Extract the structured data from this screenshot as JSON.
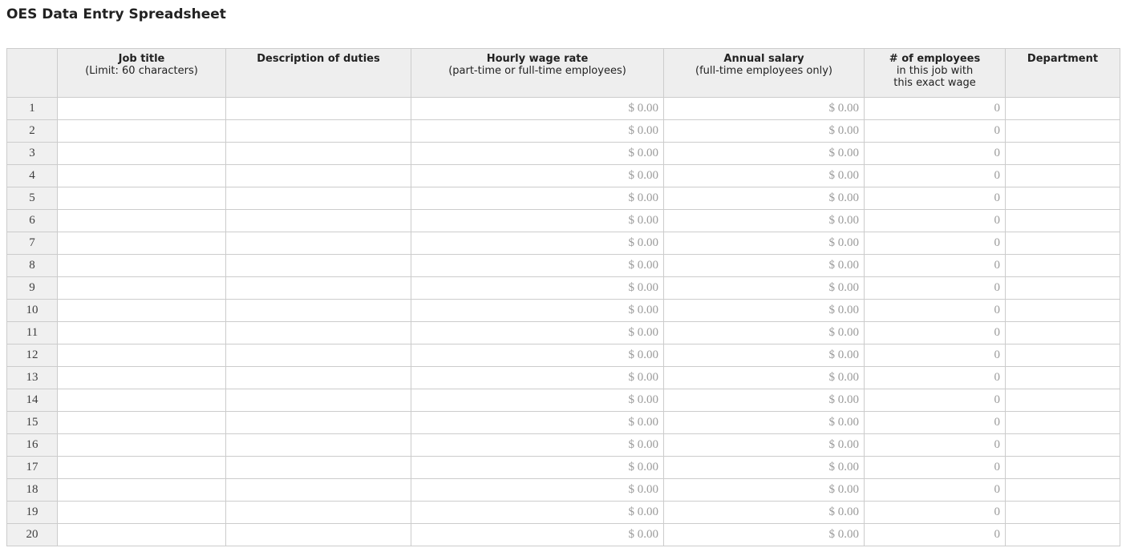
{
  "page": {
    "title": "OES Data Entry Spreadsheet"
  },
  "table": {
    "header": {
      "row_number": "",
      "job_title": {
        "label": "Job title",
        "sub": "(Limit: 60 characters)"
      },
      "description": {
        "label": "Description of duties",
        "sub": ""
      },
      "hourly_wage": {
        "label": "Hourly wage rate",
        "sub": "(part-time or full-time employees)"
      },
      "annual_salary": {
        "label": "Annual salary",
        "sub": "(full-time employees only)"
      },
      "employees": {
        "label": "# of employees",
        "sub1": "in this job with",
        "sub2": "this exact wage"
      },
      "department": {
        "label": "Department",
        "sub": ""
      }
    },
    "rows": [
      [
        "1",
        "",
        "",
        "$ 0.00",
        "$ 0.00",
        "0",
        ""
      ],
      [
        "2",
        "",
        "",
        "$ 0.00",
        "$ 0.00",
        "0",
        ""
      ],
      [
        "3",
        "",
        "",
        "$ 0.00",
        "$ 0.00",
        "0",
        ""
      ],
      [
        "4",
        "",
        "",
        "$ 0.00",
        "$ 0.00",
        "0",
        ""
      ],
      [
        "5",
        "",
        "",
        "$ 0.00",
        "$ 0.00",
        "0",
        ""
      ],
      [
        "6",
        "",
        "",
        "$ 0.00",
        "$ 0.00",
        "0",
        ""
      ],
      [
        "7",
        "",
        "",
        "$ 0.00",
        "$ 0.00",
        "0",
        ""
      ],
      [
        "8",
        "",
        "",
        "$ 0.00",
        "$ 0.00",
        "0",
        ""
      ],
      [
        "9",
        "",
        "",
        "$ 0.00",
        "$ 0.00",
        "0",
        ""
      ],
      [
        "10",
        "",
        "",
        "$ 0.00",
        "$ 0.00",
        "0",
        ""
      ],
      [
        "11",
        "",
        "",
        "$ 0.00",
        "$ 0.00",
        "0",
        ""
      ],
      [
        "12",
        "",
        "",
        "$ 0.00",
        "$ 0.00",
        "0",
        ""
      ],
      [
        "13",
        "",
        "",
        "$ 0.00",
        "$ 0.00",
        "0",
        ""
      ],
      [
        "14",
        "",
        "",
        "$ 0.00",
        "$ 0.00",
        "0",
        ""
      ],
      [
        "15",
        "",
        "",
        "$ 0.00",
        "$ 0.00",
        "0",
        ""
      ],
      [
        "16",
        "",
        "",
        "$ 0.00",
        "$ 0.00",
        "0",
        ""
      ],
      [
        "17",
        "",
        "",
        "$ 0.00",
        "$ 0.00",
        "0",
        ""
      ],
      [
        "18",
        "",
        "",
        "$ 0.00",
        "$ 0.00",
        "0",
        ""
      ],
      [
        "19",
        "",
        "",
        "$ 0.00",
        "$ 0.00",
        "0",
        ""
      ],
      [
        "20",
        "",
        "",
        "$ 0.00",
        "$ 0.00",
        "0",
        ""
      ]
    ]
  },
  "colors": {
    "header_bg": "#eeeeee",
    "row_number_bg": "#f0f0f0",
    "border": "#cccccc",
    "header_bottom_border": "#ababab",
    "value_text": "#9b9b9b",
    "title_text": "#222222"
  }
}
